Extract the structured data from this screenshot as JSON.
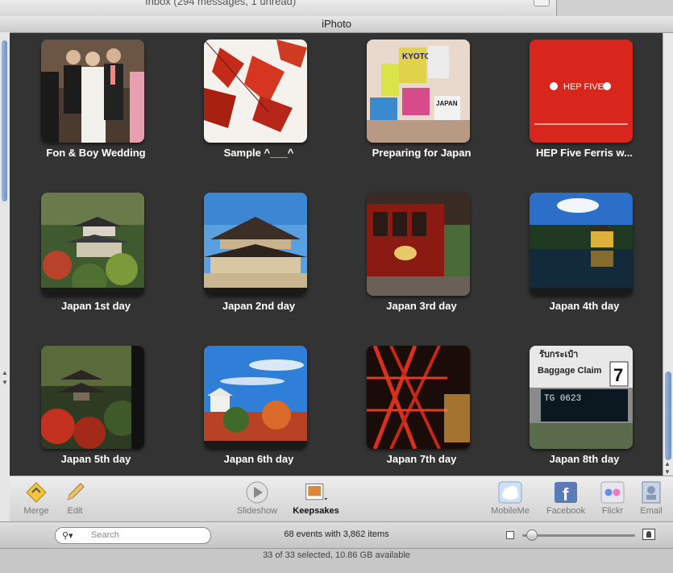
{
  "background_window": {
    "title": "Inbox (294 messages, 1 unread)"
  },
  "window": {
    "title": "iPhoto"
  },
  "events": [
    {
      "label": "Fon & Boy Wedding",
      "art": "wedding"
    },
    {
      "label": "Sample ^___^",
      "art": "leaves"
    },
    {
      "label": "Preparing for Japan",
      "art": "books"
    },
    {
      "label": "HEP Five Ferris w...",
      "art": "hep"
    },
    {
      "label": "Japan 1st day",
      "art": "pavilion"
    },
    {
      "label": "Japan 2nd day",
      "art": "temple"
    },
    {
      "label": "Japan 3rd day",
      "art": "train"
    },
    {
      "label": "Japan 4th day",
      "art": "golden"
    },
    {
      "label": "Japan 5th day",
      "art": "pagoda"
    },
    {
      "label": "Japan 6th day",
      "art": "castle"
    },
    {
      "label": "Japan 7th day",
      "art": "tower"
    },
    {
      "label": "Japan 8th day",
      "art": "baggage"
    }
  ],
  "thumb_text": {
    "kyoto": "KYOTO",
    "japan": "JAPAN",
    "hep": "HEP FIVE",
    "baggage_thai": "รับกระเป๋า",
    "baggage": "Baggage Claim",
    "baggage_number": "7",
    "flight": "TG 0623"
  },
  "toolbar": {
    "merge": "Merge",
    "edit": "Edit",
    "slideshow": "Slideshow",
    "keepsakes": "Keepsakes",
    "mobileme": "MobileMe",
    "facebook": "Facebook",
    "flickr": "Flickr",
    "email": "Email"
  },
  "status": {
    "search_placeholder": "Search",
    "events_summary": "68 events with 3,862 items",
    "zoom_level": 0.05
  },
  "footer": {
    "text": "33 of 33 selected, 10.86 GB available"
  },
  "colors": {
    "content_bg": "#333333",
    "facebook": "#3b5998",
    "flickr_pink": "#ff0084",
    "flickr_blue": "#0063dc"
  }
}
